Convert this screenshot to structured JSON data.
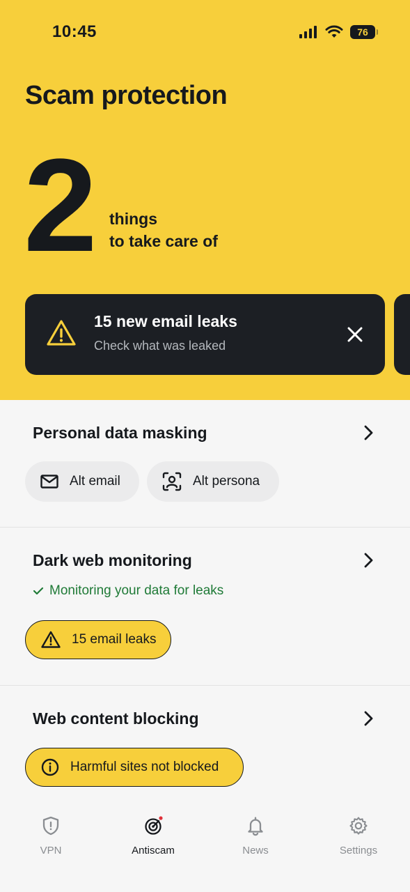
{
  "status_bar": {
    "time": "10:45",
    "battery": "76"
  },
  "hero": {
    "title": "Scam protection",
    "count": "2",
    "caption_line1": "things",
    "caption_line2": "to take care of"
  },
  "alert_card": {
    "title": "15 new email leaks",
    "subtitle": "Check what was leaked",
    "icon": "warning-icon"
  },
  "sections": {
    "masking": {
      "title": "Personal data masking",
      "chips": [
        {
          "label": "Alt email",
          "icon": "mail-icon"
        },
        {
          "label": "Alt persona",
          "icon": "persona-icon"
        }
      ]
    },
    "darkweb": {
      "title": "Dark web monitoring",
      "status": "Monitoring your data for leaks",
      "chip": {
        "label": "15 email leaks",
        "icon": "warning-icon"
      }
    },
    "blocking": {
      "title": "Web content blocking",
      "chip": {
        "label": "Harmful sites not blocked",
        "icon": "info-icon"
      }
    }
  },
  "tabbar": {
    "tabs": [
      {
        "label": "VPN",
        "icon": "shield-icon",
        "active": false
      },
      {
        "label": "Antiscam",
        "icon": "radar-icon",
        "active": true
      },
      {
        "label": "News",
        "icon": "bell-icon",
        "active": false
      },
      {
        "label": "Settings",
        "icon": "gear-icon",
        "active": false
      }
    ]
  },
  "colors": {
    "accent_yellow": "#f7cf3b",
    "dark_card": "#1c1f24",
    "success_green": "#1f7a37",
    "notification_dot": "#e0313a"
  }
}
